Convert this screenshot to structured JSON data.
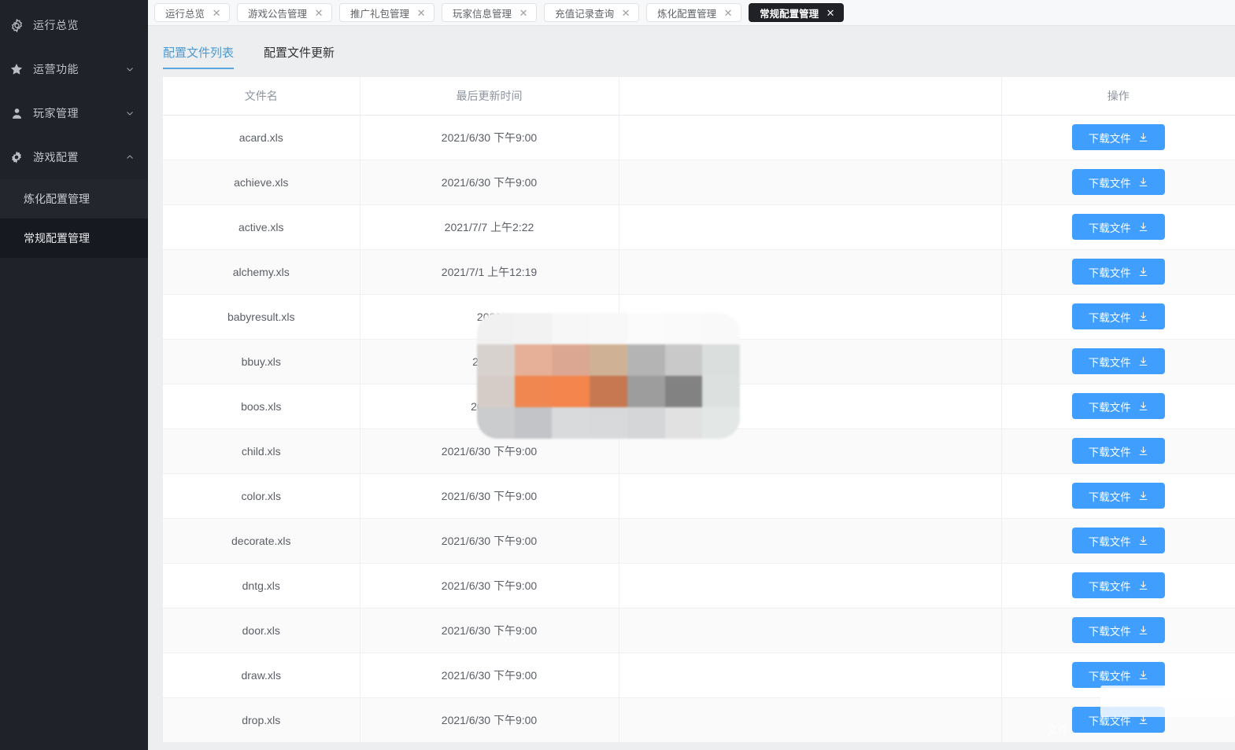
{
  "colors": {
    "sidebar_bg": "#20222a",
    "sidebar_active": "#171920",
    "accent_blue": "#409eff",
    "subtab_active": "#4d9ad1",
    "tab_active_bg": "#1f2126",
    "content_bg": "#eceef0"
  },
  "sidebar": {
    "items": [
      {
        "label": "运行总览",
        "icon": "gear-outline-icon",
        "chevron": "none"
      },
      {
        "label": "运营功能",
        "icon": "star-icon",
        "chevron": "down"
      },
      {
        "label": "玩家管理",
        "icon": "user-icon",
        "chevron": "down"
      },
      {
        "label": "游戏配置",
        "icon": "gear-solid-icon",
        "chevron": "up"
      }
    ],
    "sub_items": [
      {
        "label": "炼化配置管理",
        "active": false
      },
      {
        "label": "常规配置管理",
        "active": true
      }
    ]
  },
  "tabbar": {
    "tabs": [
      {
        "label": "运行总览",
        "active": false,
        "close": "✕"
      },
      {
        "label": "游戏公告管理",
        "active": false,
        "close": "✕"
      },
      {
        "label": "推广礼包管理",
        "active": false,
        "close": "✕"
      },
      {
        "label": "玩家信息管理",
        "active": false,
        "close": "✕"
      },
      {
        "label": "充值记录查询",
        "active": false,
        "close": "✕"
      },
      {
        "label": "炼化配置管理",
        "active": false,
        "close": "✕"
      },
      {
        "label": "常规配置管理",
        "active": true,
        "close": "✕"
      }
    ]
  },
  "subtabs": [
    {
      "label": "配置文件列表",
      "active": true
    },
    {
      "label": "配置文件更新",
      "active": false
    }
  ],
  "table": {
    "columns": [
      "文件名",
      "最后更新时间",
      "",
      "操作"
    ],
    "action_label": "下载文件",
    "action_icon": "download-icon",
    "rows": [
      {
        "file": "acard.xls",
        "time": "2021/6/30 下午9:00"
      },
      {
        "file": "achieve.xls",
        "time": "2021/6/30 下午9:00"
      },
      {
        "file": "active.xls",
        "time": "2021/7/7 上午2:22"
      },
      {
        "file": "alchemy.xls",
        "time": "2021/7/1 上午12:19"
      },
      {
        "file": "babyresult.xls",
        "time": "2021"
      },
      {
        "file": "bbuy.xls",
        "time": "2021/6"
      },
      {
        "file": "boos.xls",
        "time": "2021/6."
      },
      {
        "file": "child.xls",
        "time": "2021/6/30 下午9:00"
      },
      {
        "file": "color.xls",
        "time": "2021/6/30 下午9:00"
      },
      {
        "file": "decorate.xls",
        "time": "2021/6/30 下午9:00"
      },
      {
        "file": "dntg.xls",
        "time": "2021/6/30 下午9:00"
      },
      {
        "file": "door.xls",
        "time": "2021/6/30 下午9:00"
      },
      {
        "file": "draw.xls",
        "time": "2021/6/30 下午9:00"
      },
      {
        "file": "drop.xls",
        "time": "2021/6/30 下午9:00"
      }
    ]
  },
  "overlay": {
    "mosaic_note": "pixelated-censor-block",
    "mosaic_cells": [
      "#f1f1f1",
      "#f2f2f2",
      "#f7f7f7",
      "#f8f8f8",
      "#fbfbfb",
      "#fafafa",
      "#f9f9f9",
      "#d8d2ce",
      "#e6b098",
      "#dca792",
      "#cfb295",
      "#b4b4b4",
      "#c9c9c9",
      "#dadedd",
      "#d6ccc7",
      "#f08650",
      "#f4854c",
      "#c77850",
      "#9d9d9d",
      "#828282",
      "#dce0df",
      "#cbccce",
      "#c2c4c7",
      "#d9dadc",
      "#d8d9db",
      "#d5d6d8",
      "#e1e1e1",
      "#e3e8e7"
    ],
    "tail_label": "文件"
  }
}
